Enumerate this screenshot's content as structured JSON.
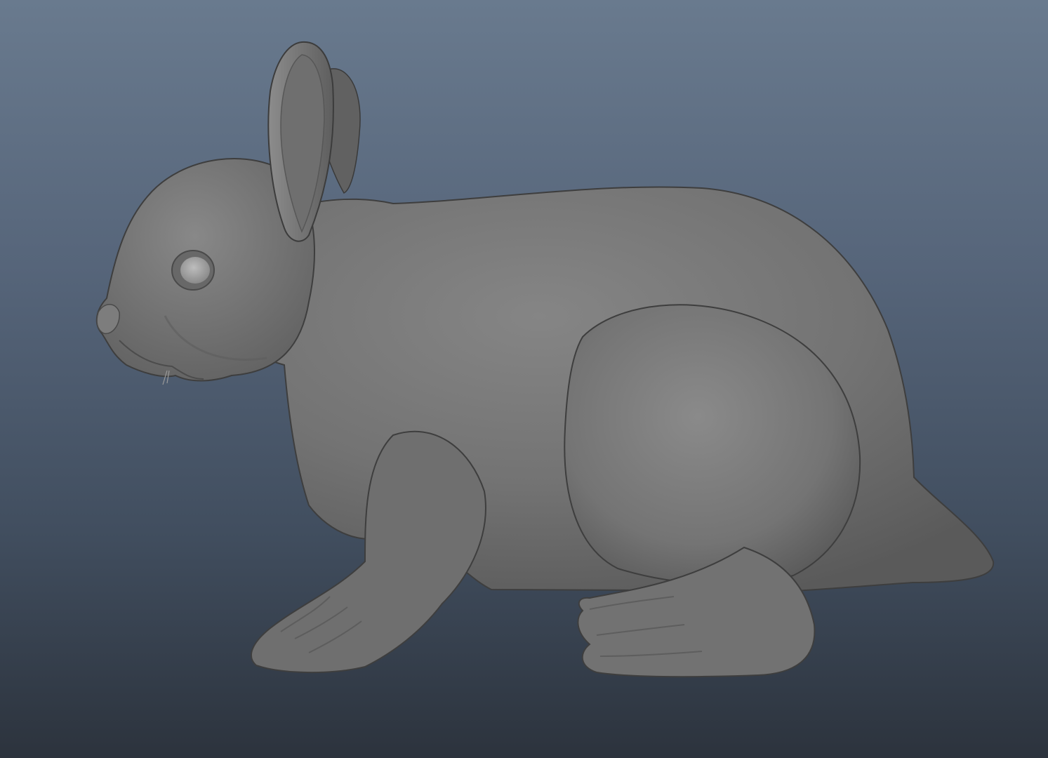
{
  "viewport": {
    "background_top": "#697a8e",
    "background_bottom": "#2c333d",
    "model": {
      "subject": "rabbit",
      "shading": "smooth-gray",
      "base_color": "#767676"
    }
  }
}
